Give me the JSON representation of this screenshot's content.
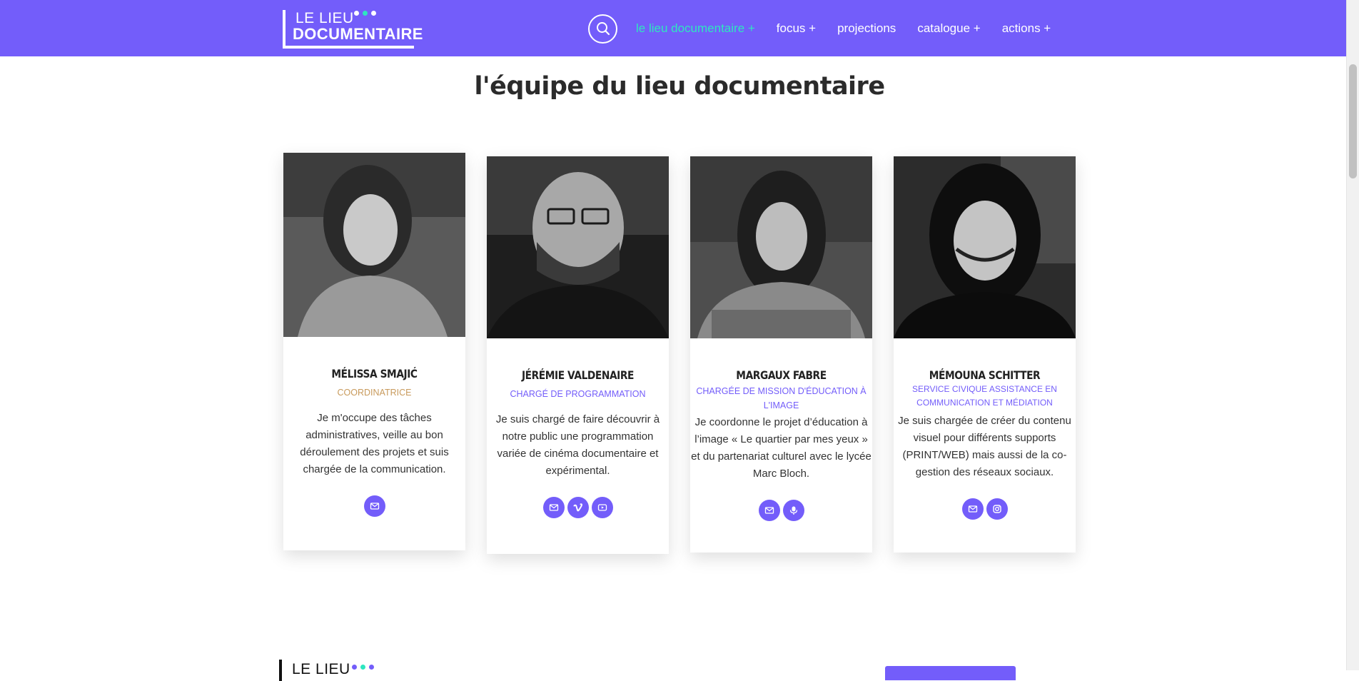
{
  "header": {
    "logo_line1": "LE LIEU",
    "logo_line2": "DOCUMENTAIRE",
    "search_icon": "search-icon",
    "nav": [
      {
        "label": "le lieu documentaire +",
        "active": true
      },
      {
        "label": "focus +",
        "active": false
      },
      {
        "label": "projections",
        "active": false
      },
      {
        "label": "catalogue +",
        "active": false
      },
      {
        "label": "actions +",
        "active": false
      }
    ]
  },
  "colors": {
    "brand": "#735dfa",
    "accent_teal": "#2ee6c0",
    "role_gold": "#c89a5c",
    "role_purple": "#735dfa"
  },
  "section": {
    "title": "l'équipe du lieu documentaire"
  },
  "team": [
    {
      "name": "MÉLISSA SMAJIĆ",
      "role": "COORDINATRICE",
      "description": "Je m'occupe des tâches administratives, veille au bon déroulement des projets et suis chargée de la communication.",
      "icons": [
        "mail-icon"
      ]
    },
    {
      "name": "JÉRÉMIE VALDENAIRE",
      "role": "CHARGÉ DE PROGRAMMATION",
      "description": "Je suis chargé de faire découvrir à notre public une programmation variée de cinéma documentaire et expérimental.",
      "icons": [
        "mail-icon",
        "vimeo-icon",
        "youtube-icon"
      ]
    },
    {
      "name": "MARGAUX FABRE",
      "role": "CHARGÉE DE MISSION D'ÉDUCATION À L'IMAGE",
      "description": "Je coordonne le projet d’éducation à l’image « Le quartier par mes yeux » et du partenariat culturel avec le lycée Marc Bloch.",
      "icons": [
        "mail-icon",
        "podcast-icon"
      ]
    },
    {
      "name": "MÉMOUNA SCHITTER",
      "role": "SERVICE CIVIQUE ASSISTANCE EN COMMUNICATION ET MÉDIATION",
      "description": "Je suis chargée de créer du contenu visuel pour différents supports (PRINT/WEB) mais aussi de la co-gestion des réseaux sociaux.",
      "icons": [
        "mail-icon",
        "instagram-icon"
      ]
    }
  ],
  "footer": {
    "logo_text": "LE LIEU"
  }
}
